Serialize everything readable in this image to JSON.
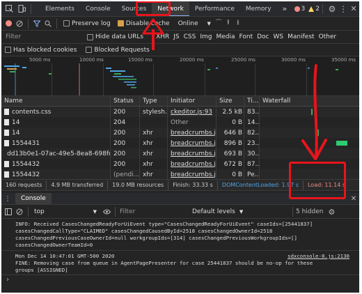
{
  "tabs": {
    "items": [
      "Elements",
      "Console",
      "Sources",
      "Network",
      "Performance",
      "Memory"
    ],
    "more": "»",
    "errors": "3",
    "warnings": "2"
  },
  "toolbar": {
    "preserve_log": "Preserve log",
    "disable_cache": "Disable cache",
    "throttle": "Online"
  },
  "filter": {
    "placeholder": "Filter",
    "hide_data_urls": "Hide data URLs",
    "types": [
      "XHR",
      "JS",
      "CSS",
      "Img",
      "Media",
      "Font",
      "Doc",
      "WS",
      "Manifest",
      "Other"
    ],
    "has_blocked_cookies": "Has blocked cookies",
    "blocked_requests": "Blocked Requests"
  },
  "overview": {
    "ticks": [
      "5000 ms",
      "10000 ms",
      "15000 ms",
      "20000 ms",
      "25000 ms",
      "30000 ms",
      "35000 ms"
    ]
  },
  "table": {
    "headers": [
      "Name",
      "Status",
      "Type",
      "Initiator",
      "Size",
      "Ti...",
      "Waterfall"
    ],
    "rows": [
      {
        "name": "contents.css",
        "status": "200",
        "type": "stylesh...",
        "initiator": "ckeditor.js:93",
        "size": "2.5 kB",
        "time": "83..."
      },
      {
        "name": "14",
        "status": "204",
        "type": "",
        "initiator": "Other",
        "size": "0 B",
        "time": "14..."
      },
      {
        "name": "14",
        "status": "200",
        "type": "xhr",
        "initiator": "breadcrumbs.j...",
        "size": "646 B",
        "time": "82..."
      },
      {
        "name": "1554431",
        "status": "200",
        "type": "xhr",
        "initiator": "breadcrumbs.j...",
        "size": "896 B",
        "time": "23..."
      },
      {
        "name": "dd13b0e1-07ac-49e5-8ea8-698fd...",
        "status": "200",
        "type": "xhr",
        "initiator": "breadcrumbs.j...",
        "size": "693 B",
        "time": "30..."
      },
      {
        "name": "1554432",
        "status": "200",
        "type": "xhr",
        "initiator": "breadcrumbs.j...",
        "size": "672 B",
        "time": "87..."
      },
      {
        "name": "1554432",
        "status": "(pendi...",
        "type": "xhr",
        "initiator": "breadcrumbs.j...",
        "size": "0 B",
        "time": "Pe..."
      }
    ]
  },
  "status": {
    "requests": "160 requests",
    "transferred": "4.9 MB transferred",
    "resources": "19.0 MB resources",
    "finish": "Finish: 33.33 s",
    "dcl": "DOMContentLoaded: 1.97 s",
    "load": "Load: 11.14 s"
  },
  "drawer": {
    "tab": "Console"
  },
  "console": {
    "context": "top",
    "filter_placeholder": "Filter",
    "levels": "Default levels",
    "hidden": "5 hidden",
    "lines": [
      "INFO: Received CasesChangedReadyForUiEvent type=\"CasesChangedReadyForUiEvent\" caseIds=[25441837]",
      "casesChangedCallType=\"CLAIMED\" casesChangedCausedById=2518 casesChangedOwnerId=2518",
      "casesChangedPreviousCaseOwnerId=null workgroupIds=[314] casesChangedPreviousWorkgroupIds=[]",
      "casesChangedOwnerTeamId=0"
    ],
    "timestamp": "Mon Dec 14 10:47:01 GMT-500 2020",
    "source": "sdxconsole-0.js:2130",
    "lines2": [
      "FINE: Removing case from queue in AgentPagePresenter for case 25441837 should be no-op for these",
      "groups [ASSIGNED]"
    ],
    "prompt": "›"
  },
  "colors": {
    "accent": "#8ab4f8",
    "annotation": "#e8141c",
    "error": "#f28b82",
    "warning": "#fdd663",
    "dcl": "#4ea7e8",
    "load": "#f28b82"
  }
}
